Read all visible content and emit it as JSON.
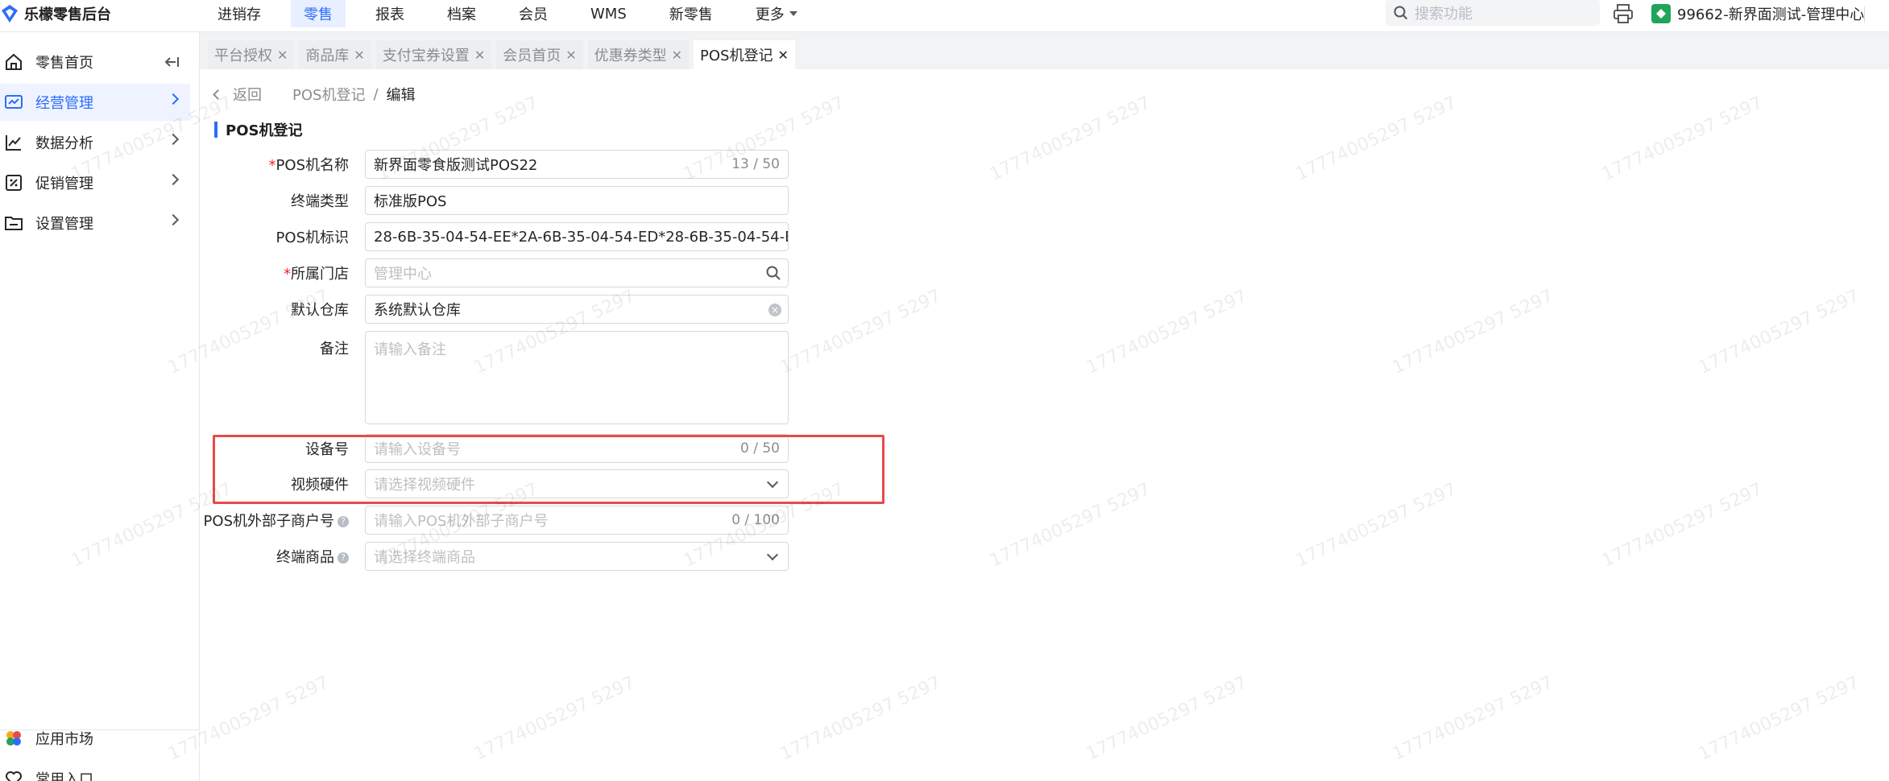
{
  "app": {
    "title": "乐檬零售后台"
  },
  "topnav": {
    "items": [
      {
        "label": "进销存",
        "active": false
      },
      {
        "label": "零售",
        "active": true
      },
      {
        "label": "报表",
        "active": false
      },
      {
        "label": "档案",
        "active": false
      },
      {
        "label": "会员",
        "active": false
      },
      {
        "label": "WMS",
        "active": false
      },
      {
        "label": "新零售",
        "active": false
      },
      {
        "label": "更多",
        "active": false
      }
    ],
    "search_placeholder": "搜索功能",
    "store_name": "99662-新界面测试-管理中心"
  },
  "sidebar": {
    "items": [
      {
        "label": "零售首页",
        "icon": "home-icon"
      },
      {
        "label": "经营管理",
        "icon": "chart-board-icon"
      },
      {
        "label": "数据分析",
        "icon": "line-chart-icon"
      },
      {
        "label": "促销管理",
        "icon": "promotion-icon"
      },
      {
        "label": "设置管理",
        "icon": "folder-icon"
      }
    ],
    "bottom": [
      {
        "label": "应用市场",
        "icon": "app-market-icon"
      },
      {
        "label": "常用入口",
        "icon": "heart-icon"
      }
    ]
  },
  "tabs": [
    {
      "label": "平台授权"
    },
    {
      "label": "商品库"
    },
    {
      "label": "支付宝券设置"
    },
    {
      "label": "会员首页"
    },
    {
      "label": "优惠券类型"
    },
    {
      "label": "POS机登记"
    }
  ],
  "breadcrumb": {
    "back": "返回",
    "parent": "POS机登记",
    "sep": "/",
    "current": "编辑"
  },
  "form": {
    "title": "POS机登记",
    "pos_name": {
      "label": "POS机名称",
      "value": "新界面零食版测试POS22",
      "count": "13 / 50"
    },
    "terminal_type": {
      "label": "终端类型",
      "value": "标准版POS"
    },
    "pos_id": {
      "label": "POS机标识",
      "value": "28-6B-35-04-54-EE*2A-6B-35-04-54-ED*28-6B-35-04-54-ED*28-6"
    },
    "store": {
      "label": "所属门店",
      "placeholder": "管理中心"
    },
    "warehouse": {
      "label": "默认仓库",
      "value": "系统默认仓库"
    },
    "remark": {
      "label": "备注",
      "placeholder": "请输入备注"
    },
    "device_no": {
      "label": "设备号",
      "placeholder": "请输入设备号",
      "count": "0 / 50"
    },
    "video_hw": {
      "label": "视频硬件",
      "placeholder": "请选择视频硬件"
    },
    "sub_merchant": {
      "label": "POS机外部子商户号",
      "placeholder": "请输入POS机外部子商户号",
      "count": "0 / 100"
    },
    "terminal_goods": {
      "label": "终端商品",
      "placeholder": "请选择终端商品"
    },
    "required_mark": "*",
    "help_mark": "?"
  },
  "watermark": "17774005297 5297",
  "colors": {
    "accent": "#2d6df6",
    "highlight": "#e84a4a",
    "required": "#f5222d"
  }
}
